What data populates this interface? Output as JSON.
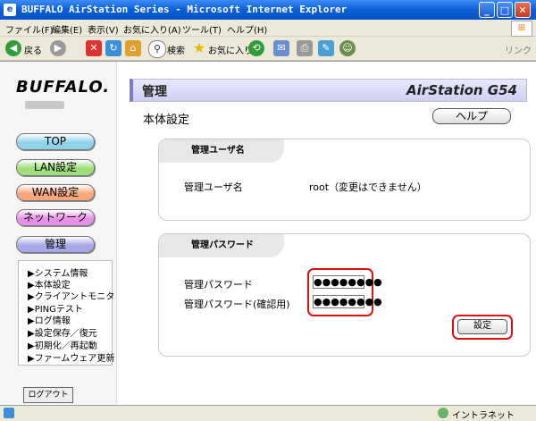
{
  "window": {
    "title": "BUFFALO AirStation Series - Microsoft Internet Explorer"
  },
  "menubar": {
    "items": [
      "ファイル(F)",
      "編集(E)",
      "表示(V)",
      "お気に入り(A)",
      "ツール(T)",
      "ヘルプ(H)"
    ]
  },
  "toolbar": {
    "back_label": "戻る",
    "search_label": "検索",
    "favorites_label": "お気に入り",
    "links_label": "リンク"
  },
  "sidebar": {
    "brand": "BUFFALO.",
    "nav": [
      {
        "label": "TOP",
        "color": "#8fd3e8"
      },
      {
        "label": "LAN設定",
        "color": "#9fe07a"
      },
      {
        "label": "WAN設定",
        "color": "#f5a67a"
      },
      {
        "label": "ネットワーク",
        "color": "#e890e8"
      },
      {
        "label": "管理",
        "color": "#a8a8e8"
      }
    ],
    "submenu": [
      "システム情報",
      "本体設定",
      "クライアントモニタ",
      "PINGテスト",
      "ログ情報",
      "設定保存／復元",
      "初期化／再起動",
      "ファームウェア更新"
    ],
    "logout_label": "ログアウト"
  },
  "header": {
    "title": "管理",
    "product": "AirStation G54"
  },
  "main": {
    "page_title": "本体設定",
    "help_label": "ヘルプ",
    "user_section": {
      "heading": "管理ユーザ名",
      "field_label": "管理ユーザ名",
      "value": "root（変更はできません）"
    },
    "password_section": {
      "heading": "管理パスワード",
      "password_label": "管理パスワード",
      "password_value": "●●●●●●●●",
      "confirm_label": "管理パスワード(確認用)",
      "confirm_value": "●●●●●●●●",
      "submit_label": "設定"
    }
  },
  "statusbar": {
    "zone": "イントラネット"
  }
}
